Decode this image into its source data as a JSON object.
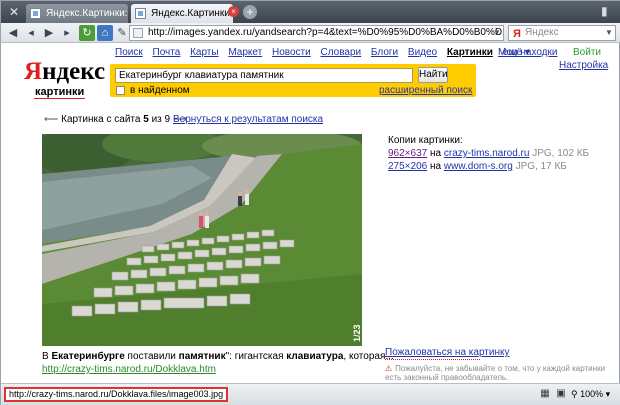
{
  "browser": {
    "tabs": [
      {
        "label": "Яндекс.Картинки: Ека..."
      },
      {
        "label": "Яндекс.Картинки: Ека..."
      }
    ],
    "url": "http://images.yandex.ru/yandsearch?p=4&text=%D0%95%D0%BA%D0%B0%D1%82%D0%B5%D1%80%D0%B8%D0%BD%D0%B1%D1%83%D1%80%D0%B3",
    "search_placeholder": "Яндекс",
    "search_logo": "Я",
    "status_url": "http://crazy-tims.narod.ru/Dokklava.files/image003.jpg",
    "zoom": "100%"
  },
  "header": {
    "services": [
      "Поиск",
      "Почта",
      "Карты",
      "Маркет",
      "Новости",
      "Словари",
      "Блоги",
      "Видео"
    ],
    "current_service": "Картинки",
    "more": "ещё ▾",
    "my_finds": "Мои находки",
    "login": "Войти",
    "settings": "Настройка",
    "logo_first": "Я",
    "logo_rest": "ндекс",
    "logo_sub": "картинки"
  },
  "search": {
    "query": "Екатеринбург клавиатура памятник",
    "button": "Найти",
    "checkbox_label": "в найденном",
    "advanced": "расширенный поиск"
  },
  "viewer": {
    "pager_prefix": "Картинка с сайта",
    "pager_current": "5",
    "pager_of": "из",
    "pager_total": "9",
    "back": "Вернуться к результатам поиска",
    "copies_title": "Копии картинки:",
    "copies": [
      {
        "dims": "962×637",
        "on": "на",
        "host": "crazy-tims.narod.ru",
        "meta": "JPG, 102 КБ"
      },
      {
        "dims": "275×206",
        "on": "на",
        "host": "www.dom-s.org",
        "meta": "JPG, 17 КБ"
      }
    ],
    "caption_pre": "В ",
    "caption_b1": "Екатеринбурге",
    "caption_mid1": " поставили ",
    "caption_b2": "памятник",
    "caption_mid2": "\": гигантская ",
    "caption_b3": "клавиатура",
    "caption_end": ", которая...",
    "caption_url": "http://crazy-tims.narod.ru/Dokklava.htm",
    "complain": "Пожаловаться на картинку",
    "warning": "Пожалуйста, не забывайте о том, что у каждой картинки есть законный правообладатель.",
    "photo_watermark": "1/23"
  }
}
